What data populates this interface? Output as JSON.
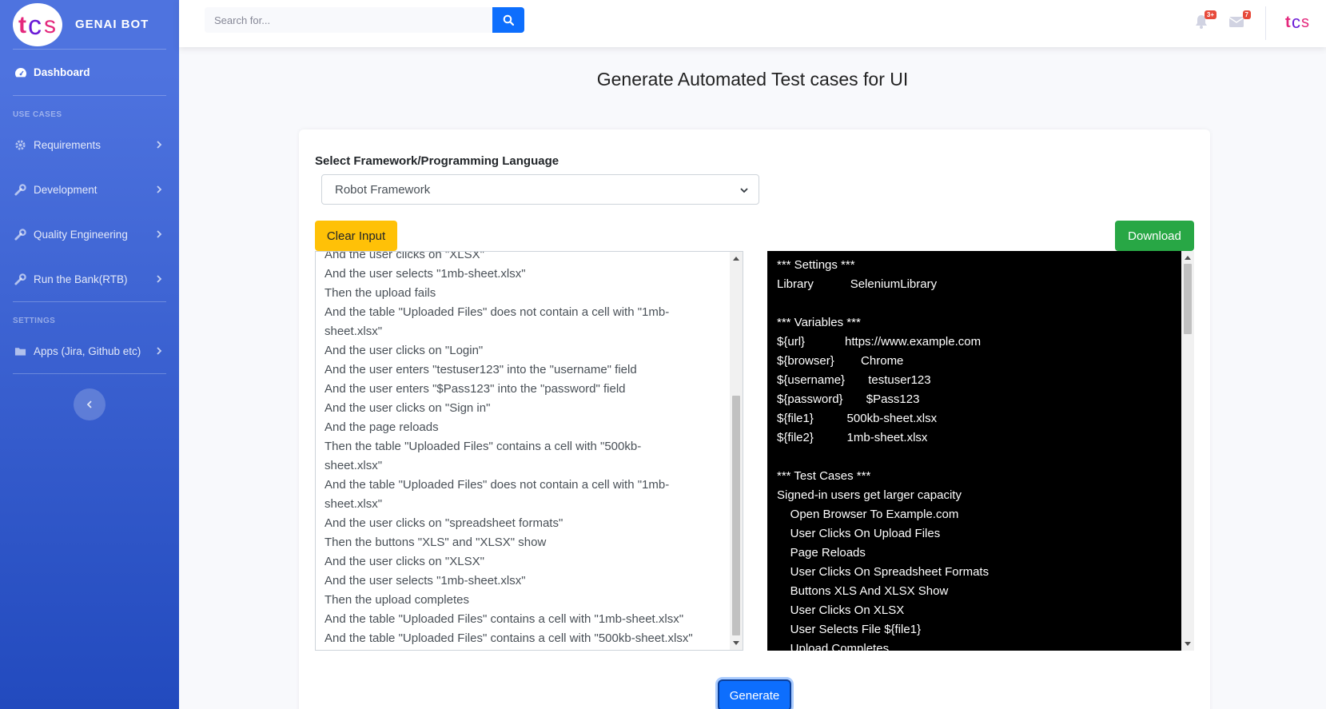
{
  "sidebar": {
    "brand_name": "GENAI BOT",
    "dashboard": "Dashboard",
    "use_cases_heading": "USE CASES",
    "items": [
      {
        "label": "Requirements"
      },
      {
        "label": "Development"
      },
      {
        "label": "Quality Engineering"
      },
      {
        "label": "Run the Bank(RTB)"
      }
    ],
    "settings_heading": "SETTINGS",
    "apps_label": "Apps (Jira, Github etc)"
  },
  "topbar": {
    "search_placeholder": "Search for...",
    "alerts_badge": "3+",
    "messages_badge": "7"
  },
  "main": {
    "title": "Generate Automated Test cases for UI",
    "framework_label": "Select Framework/Programming Language",
    "framework_selected": "Robot Framework",
    "clear_button": "Clear Input",
    "download_button": "Download",
    "generate_button": "Generate",
    "input_lines": [
      "And the user clicks on \"XLSX\"",
      "And the user selects \"1mb-sheet.xlsx\"",
      "Then the upload fails",
      "And the table \"Uploaded Files\" does not contain a cell with \"1mb-",
      "sheet.xlsx\"",
      "And the user clicks on \"Login\"",
      "And the user enters \"testuser123\" into the \"username\" field",
      "And the user enters \"$Pass123\" into the \"password\" field",
      "And the user clicks on \"Sign in\"",
      "And the page reloads",
      "Then the table \"Uploaded Files\" contains a cell with \"500kb-",
      "sheet.xlsx\"",
      "And the table \"Uploaded Files\" does not contain a cell with \"1mb-",
      "sheet.xlsx\"",
      "And the user clicks on \"spreadsheet formats\"",
      "Then the buttons \"XLS\" and \"XLSX\" show",
      "And the user clicks on \"XLSX\"",
      "And the user selects \"1mb-sheet.xlsx\"",
      "Then the upload completes",
      "And the table \"Uploaded Files\" contains a cell with \"1mb-sheet.xlsx\"",
      "And the table \"Uploaded Files\" contains a cell with \"500kb-sheet.xlsx\""
    ],
    "output_lines": [
      "*** Settings ***",
      "Library           SeleniumLibrary",
      "",
      "*** Variables ***",
      "${url}            https://www.example.com",
      "${browser}        Chrome",
      "${username}       testuser123",
      "${password}       $Pass123",
      "${file1}          500kb-sheet.xlsx",
      "${file2}          1mb-sheet.xlsx",
      "",
      "*** Test Cases ***",
      "Signed-in users get larger capacity",
      "    Open Browser To Example.com",
      "    User Clicks On Upload Files",
      "    Page Reloads",
      "    User Clicks On Spreadsheet Formats",
      "    Buttons XLS And XLSX Show",
      "    User Clicks On XLSX",
      "    User Selects File ${file1}",
      "    Upload Completes"
    ]
  }
}
